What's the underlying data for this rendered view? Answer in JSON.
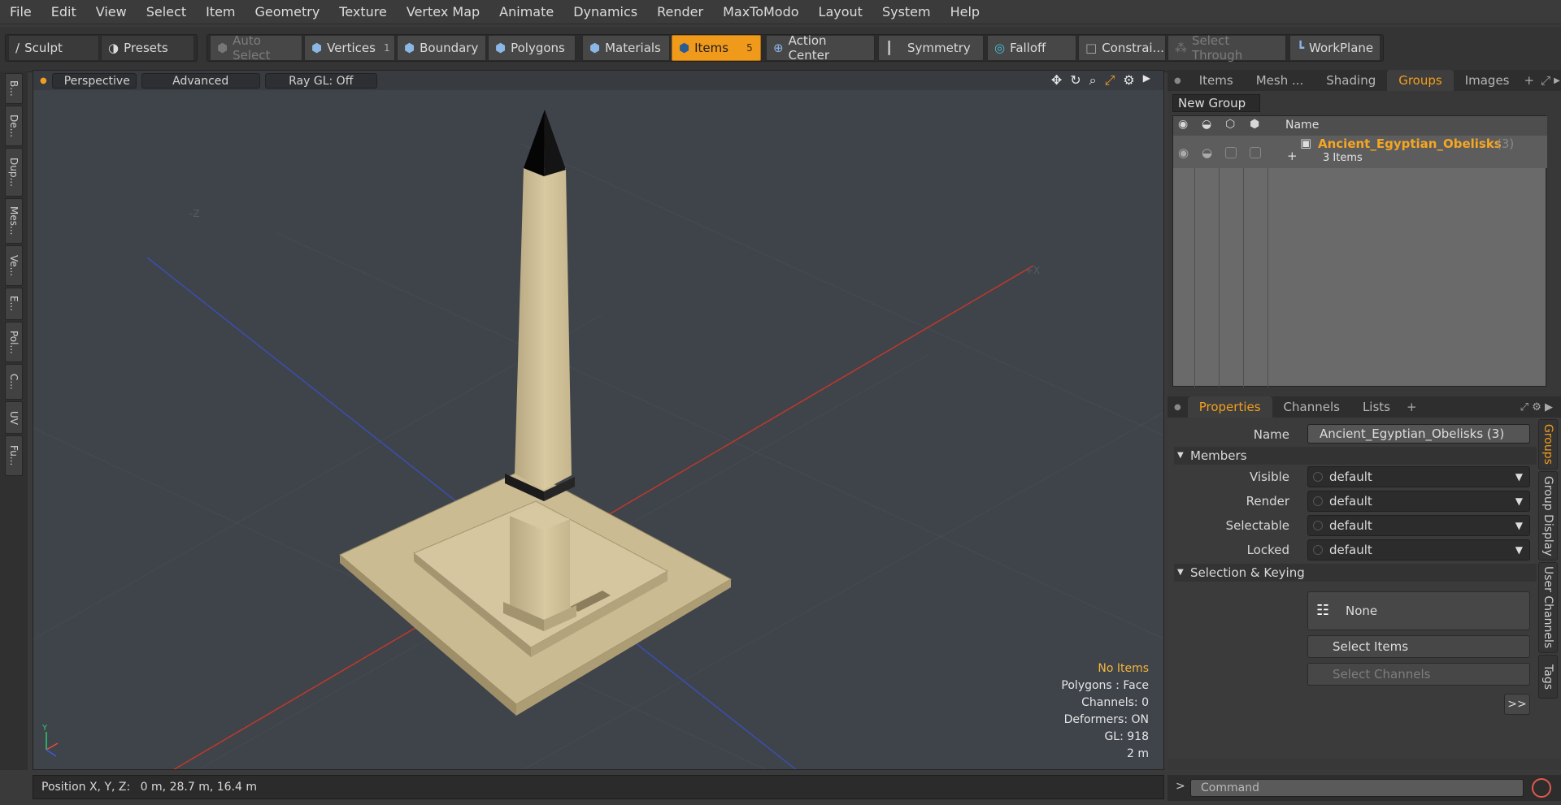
{
  "menu": [
    "File",
    "Edit",
    "View",
    "Select",
    "Item",
    "Geometry",
    "Texture",
    "Vertex Map",
    "Animate",
    "Dynamics",
    "Render",
    "MaxToModo",
    "Layout",
    "System",
    "Help"
  ],
  "toolbar": {
    "sculpt": "Sculpt",
    "presets": "Presets",
    "auto_select": "Auto Select",
    "vertices": "Vertices",
    "vertices_count": "1",
    "boundary": "Boundary",
    "polygons": "Polygons",
    "materials": "Materials",
    "items": "Items",
    "items_count": "5",
    "action_center": "Action Center",
    "symmetry": "Symmetry",
    "falloff": "Falloff",
    "constraints": "Constrai...",
    "select_through": "Select Through",
    "workplane": "WorkPlane"
  },
  "left_tabs": [
    "B...",
    "De...",
    "Dup...",
    "Mes...",
    "Ve...",
    "E...",
    "Pol...",
    "C...",
    "UV",
    "Fu..."
  ],
  "viewport": {
    "view_mode": "Perspective",
    "render_mode": "Advanced",
    "raygl": "Ray GL: Off",
    "info": {
      "selection": "No Items",
      "polygons": "Polygons : Face",
      "channels": "Channels: 0",
      "deformers": "Deformers: ON",
      "gl": "GL: 918",
      "scale": "2 m"
    }
  },
  "status": {
    "label": "Position X, Y, Z:",
    "value": "0 m, 28.7 m, 16.4 m"
  },
  "groups_panel": {
    "tabs": [
      "Items",
      "Mesh ...",
      "Shading",
      "Groups",
      "Images"
    ],
    "active_tab": "Groups",
    "new_group": "New Group",
    "name_header": "Name",
    "group": {
      "name": "Ancient_Egyptian_Obelisks",
      "count": "(3)",
      "sub": "3 Items"
    }
  },
  "properties": {
    "tabs": [
      "Properties",
      "Channels",
      "Lists"
    ],
    "active_tab": "Properties",
    "name_label": "Name",
    "name_value": "Ancient_Egyptian_Obelisks (3)",
    "members_section": "Members",
    "fields": [
      {
        "label": "Visible",
        "value": "default"
      },
      {
        "label": "Render",
        "value": "default"
      },
      {
        "label": "Selectable",
        "value": "default"
      },
      {
        "label": "Locked",
        "value": "default"
      }
    ],
    "keying_section": "Selection & Keying",
    "keying_value": "None",
    "select_items": "Select Items",
    "select_channels": "Select Channels",
    "more": ">>"
  },
  "side_tabs": [
    "Groups",
    "Group Display",
    "User Channels",
    "Tags"
  ],
  "command": {
    "prompt": ">",
    "placeholder": "Command"
  },
  "colors": {
    "accent": "#f09a1b",
    "group_name": "#f5a623",
    "warn_text": "#f5b63c"
  }
}
